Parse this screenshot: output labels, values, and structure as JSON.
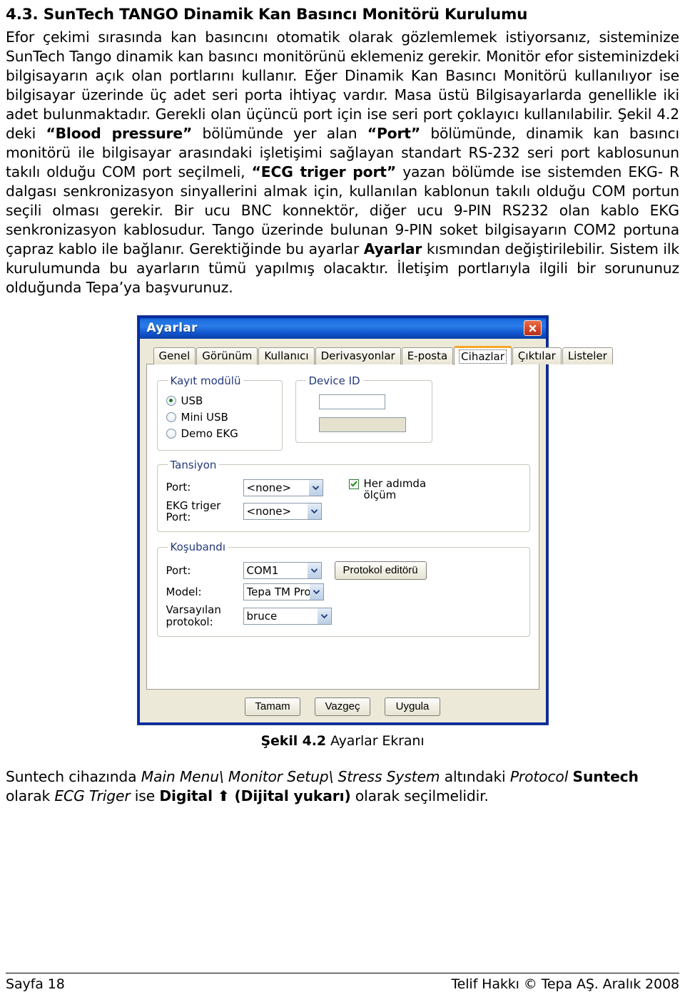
{
  "document": {
    "section_title": "4.3. SunTech TANGO Dinamik Kan Basıncı Monitörü Kurulumu",
    "paragraph_1": {
      "t1": "Efor çekimi sırasında kan basıncını otomatik olarak gözlemlemek istiyorsanız, sisteminize SunTech Tango dinamik kan basıncı monitörünü eklemeniz gerekir. Monitör efor sisteminizdeki bilgisayarın açık olan portlarını kullanır. Eğer Dinamik Kan Basıncı Monitörü kullanılıyor ise bilgisayar üzerinde üç adet seri porta ihtiyaç vardır. Masa üstü Bilgisayarlarda genellikle iki adet bulunmaktadır. Gerekli olan üçüncü port için ise seri port çoklayıcı kullanılabilir. Şekil 4.2 deki ",
      "b1": "“Blood pressure”",
      "t2": " bölümünde yer alan ",
      "b2": "“Port”",
      "t3": " bölümünde, dinamik kan basıncı monitörü ile bilgisayar arasındaki işletişimi sağlayan standart RS-232 seri port kablosunun takılı olduğu COM port seçilmeli, ",
      "b3": "“ECG triger port”",
      "t4": " yazan bölümde ise sistemden EKG- R dalgası senkronizasyon sinyallerini almak için, kullanılan kablonun takılı olduğu COM portun seçili olması gerekir. Bir ucu BNC konnektör, diğer ucu 9-PIN RS232 olan kablo EKG senkronizasyon kablosudur. Tango üzerinde bulunan 9-PIN soket bilgisayarın COM2 portuna çapraz kablo ile bağlanır. Gerektiğinde bu ayarlar ",
      "b4": "Ayarlar",
      "t5": " kısmından değiştirilebilir. Sistem ilk kurulumunda bu ayarların tümü yapılmış olacaktır. İletişim portlarıyla ilgili bir sorununuz olduğunda Tepa’ya başvurunuz."
    },
    "figure_caption": {
      "number": "Şekil 4.2",
      "text": " Ayarlar Ekranı"
    },
    "trailer": {
      "t1": "Suntech cihazında ",
      "i1": "Main Menu\\ Monitor Setup\\ Stress System",
      "t2": " altındaki ",
      "i2": "Protocol",
      "t3": "  ",
      "b1": "Suntech",
      "t4": " olarak ",
      "i3": "ECG Triger",
      "t5": " ise ",
      "b2": "Digital ⬆ (Dijital yukarı)",
      "t6": " olarak seçilmelidir."
    },
    "footer": {
      "left": "Sayfa 18",
      "right": "Telif Hakkı © Tepa AŞ. Aralık 2008"
    }
  },
  "dialog": {
    "title": "Ayarlar",
    "close_icon": "close-icon",
    "tabs": [
      {
        "label": "Genel",
        "active": false
      },
      {
        "label": "Görünüm",
        "active": false
      },
      {
        "label": "Kullanıcı",
        "active": false
      },
      {
        "label": "Derivasyonlar",
        "active": false
      },
      {
        "label": "E-posta",
        "active": false
      },
      {
        "label": "Cihazlar",
        "active": true
      },
      {
        "label": "Çıktılar",
        "active": false
      },
      {
        "label": "Listeler",
        "active": false
      }
    ],
    "groups": {
      "kayit_modulu": {
        "legend": "Kayıt modülü",
        "options": [
          {
            "label": "USB",
            "checked": true
          },
          {
            "label": "Mini USB",
            "checked": false
          },
          {
            "label": "Demo EKG",
            "checked": false
          }
        ]
      },
      "device_id": {
        "legend": "Device ID",
        "field_value": "",
        "field_disabled_value": ""
      },
      "tansiyon": {
        "legend": "Tansiyon",
        "port_label": "Port:",
        "port_value": "<none>",
        "ekg_triger_label": "EKG triger\nPort:",
        "ekg_triger_label_line1": "EKG triger",
        "ekg_triger_label_line2": "Port:",
        "ekg_triger_value": "<none>",
        "checkbox_label_line1": "Her adımda",
        "checkbox_label_line2": "ölçüm",
        "checkbox_checked": true
      },
      "kosubandi": {
        "legend": "Koşubandı",
        "port_label": "Port:",
        "port_value": "COM1",
        "model_label": "Model:",
        "model_value": "Tepa TM Pro",
        "protokol_label_line1": "Varsayılan",
        "protokol_label_line2": "protokol:",
        "protokol_value": "bruce",
        "editor_button": "Protokol editörü"
      }
    },
    "buttons": {
      "ok": "Tamam",
      "cancel": "Vazgeç",
      "apply": "Uygula"
    },
    "colors": {
      "titlebar_blue": "#1e6fe0",
      "border_blue": "#0a2a9c",
      "face": "#ece9d8",
      "active_tab_accent": "#f5a623",
      "close_red": "#d8472a",
      "legend_text": "#24387a"
    }
  }
}
